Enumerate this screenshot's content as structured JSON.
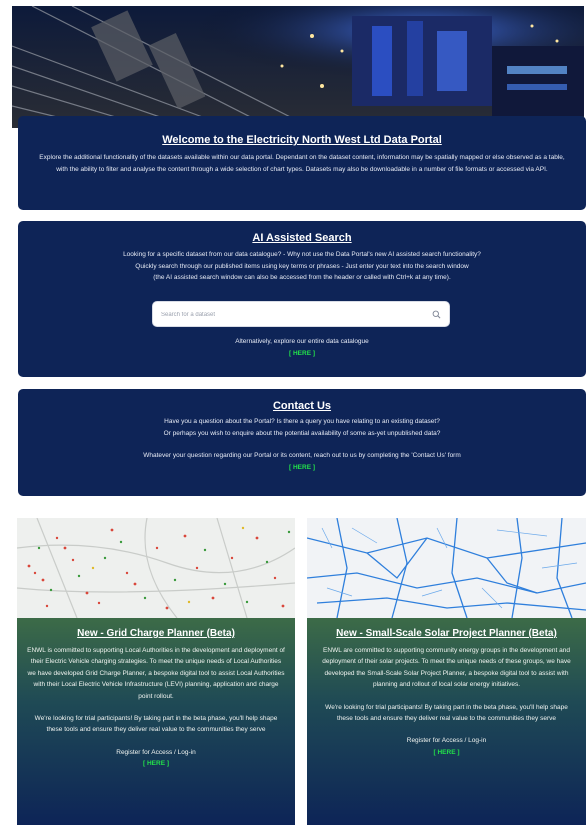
{
  "welcome": {
    "title": "Welcome to the Electricity North West Ltd Data Portal",
    "text": "Explore the additional functionality of the datasets available within our data portal. Dependant on the dataset content, information may be spatially mapped or else observed as a table, with the ability to filter and analyse the content through a wide selection of chart types. Datasets may also be downloadable in a number of file formats or accessed via API."
  },
  "ai_search": {
    "title": "AI Assisted Search",
    "line1": "Looking for a specific dataset from our data catalogue? - Why not use the Data Portal's new AI assisted search functionality?",
    "line2": "Quickly search through our published items using key terms or phrases - Just enter your text into the search window",
    "line3": "(the AI assisted search window can also be accessed from the header or called with Ctrl+k at any time).",
    "placeholder": "Search for a dataset",
    "alt_text": "Alternatively, explore our entire data catalogue",
    "here": "[ HERE ]"
  },
  "contact": {
    "title": "Contact Us",
    "line1": "Have you a question about the Portal? Is there a query you have relating to an existing dataset?",
    "line2": "Or perhaps you wish to enquire about the potential availability of some as-yet unpublished data?",
    "line3": "Whatever your question regarding our Portal or its content, reach out to us by completing the 'Contact Us' form",
    "here": "[ HERE ]"
  },
  "promos": {
    "grid": {
      "title": "New - Grid Charge Planner (Beta)",
      "para1": "ENWL is committed to supporting Local Authorities in the development and deployment of their Electric Vehicle charging strategies. To meet the unique needs of Local Authorities we have developed Grid Charge Planner, a bespoke digital tool to assist Local Authorities with their Local Electric Vehicle Infrastructure (LEVI) planning, application and charge point rollout.",
      "para2": "We're looking for trial participants! By taking part in the beta phase, you'll help shape these tools and ensure they deliver real value to the communities they serve",
      "register": "Register for Access / Log-in",
      "here": "[ HERE ]"
    },
    "solar": {
      "title": "New - Small-Scale Solar Project Planner (Beta)",
      "para1": "ENWL are committed to supporting community energy groups in the development and deployment of their solar projects. To meet the unique needs of these groups, we have developed the Small-Scale Solar Project Planner, a bespoke digital tool to assist with planning and rollout of local solar energy initiatives.",
      "para2": "We're looking for trial participants! By taking part in the beta phase, you'll help shape these tools and ensure they deliver real value to the communities they serve",
      "register": "Register for Access / Log-in",
      "here": "[ HERE ]"
    }
  },
  "colors": {
    "card_bg": "#0e2457",
    "here_link": "#22e04a"
  }
}
